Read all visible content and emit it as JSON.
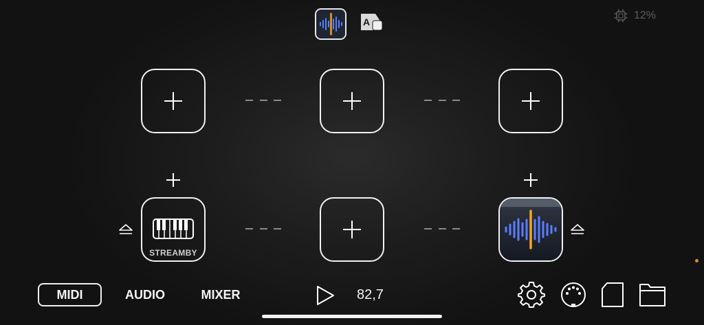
{
  "header": {
    "cpu_usage": "12%"
  },
  "chain": {
    "top_row_slots": [
      "add-slot",
      "add-slot",
      "add-slot"
    ],
    "bottom_row": {
      "left_slot_caption": "STREAMBY",
      "middle_slot": "add-slot",
      "right_slot": "waveform-plugin"
    }
  },
  "bottom_bar": {
    "tabs": [
      {
        "label": "MIDI",
        "selected": true
      },
      {
        "label": "AUDIO",
        "selected": false
      },
      {
        "label": "MIXER",
        "selected": false
      }
    ],
    "tempo": "82,7"
  },
  "colors": {
    "accent_orange": "#f5a623",
    "wave_blue": "#5b7dff",
    "cpu_text": "#5c5c5c",
    "edge_dot": "#e08a2c"
  },
  "icons": {
    "settings": "gear-icon",
    "midi": "midi-din-icon",
    "document": "document-icon",
    "folder": "folder-icon",
    "play": "play-icon",
    "cpu": "cpu-chip-icon",
    "eject": "eject-icon"
  }
}
